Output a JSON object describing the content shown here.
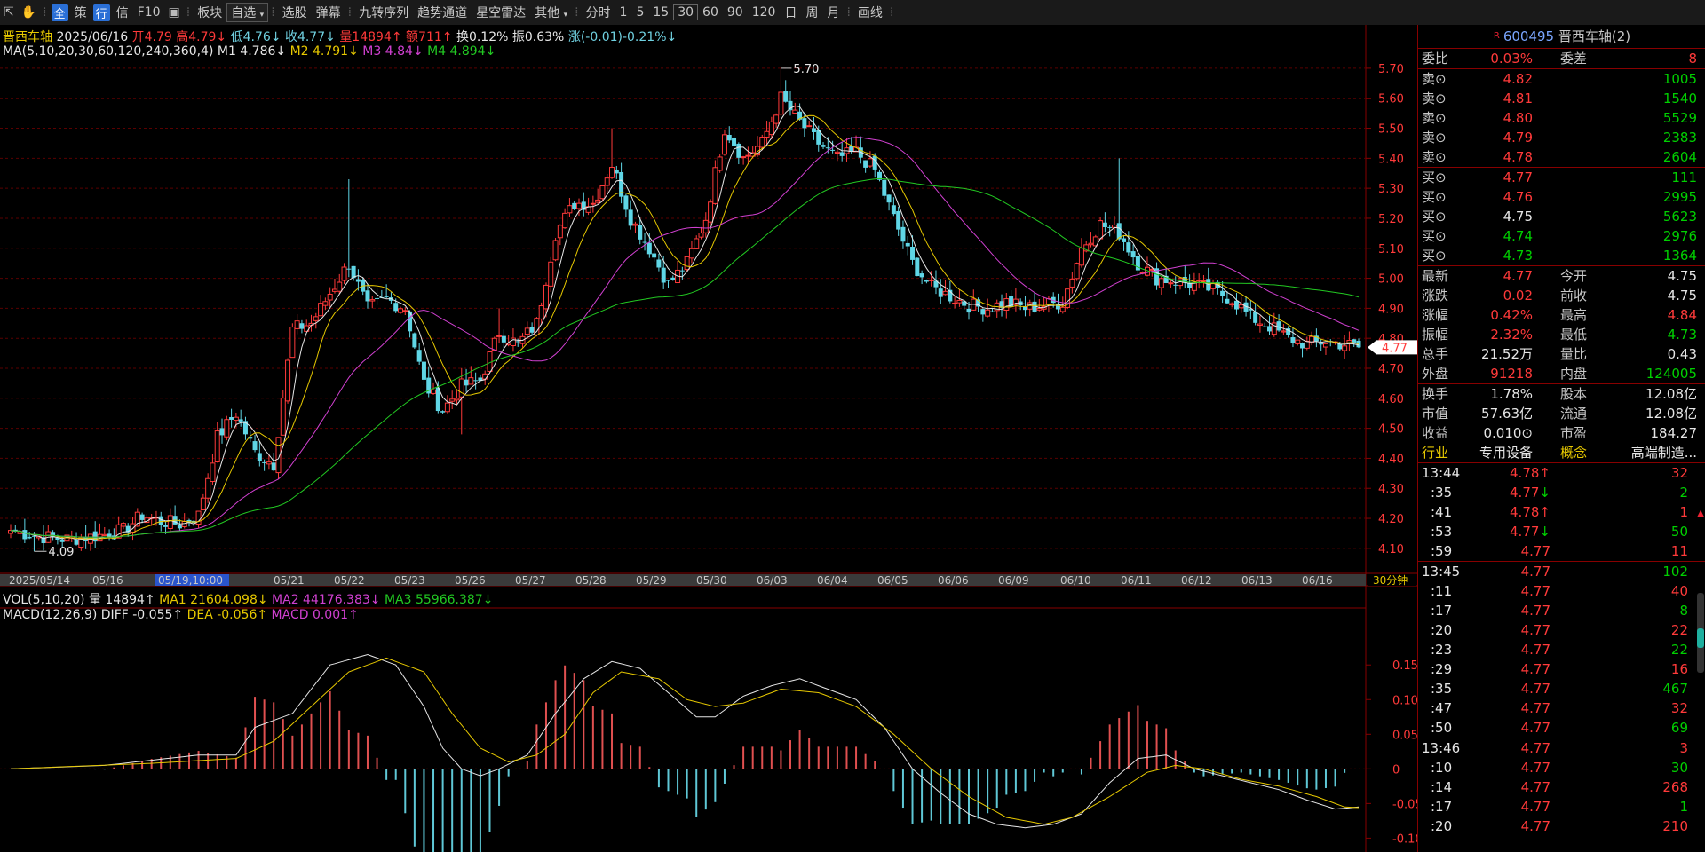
{
  "toolbar": {
    "items": [
      "全",
      "策",
      "行",
      "信",
      "F10",
      "板块",
      "自选",
      "选股",
      "弹幕",
      "九转序列",
      "趋势通道",
      "星空雷达",
      "其他",
      "分时",
      "1",
      "5",
      "15",
      "30",
      "60",
      "90",
      "120",
      "日",
      "周",
      "月",
      "画线"
    ]
  },
  "stock": {
    "name": "晋西车轴",
    "date": "2025/06/16",
    "open": "开4.79",
    "high": "高4.79↓",
    "low": "低4.76↓",
    "close": "收4.77↓",
    "vol": "量14894↑",
    "amt": "额711↑",
    "turn": "换0.12%",
    "amp": "振0.63%",
    "chg": "涨(-0.01)-0.21%↓"
  },
  "ma": {
    "label": "MA(5,10,20,30,60,120,240,360,4)",
    "m1": "M1 4.786↓",
    "m2": "M2 4.791↓",
    "m3": "M3 4.84↓",
    "m4": "M4 4.894↓"
  },
  "vol_ind": {
    "label": "VOL(5,10,20)",
    "v": "量 14894↑",
    "ma1": "MA1 21604.098↓",
    "ma2": "MA2 44176.383↓",
    "ma3": "MA3 55966.387↓"
  },
  "macd": {
    "label": "MACD(12,26,9)",
    "diff": "DIFF -0.055↑",
    "dea": "DEA -0.056↑",
    "macd": "MACD 0.001↑"
  },
  "colors": {
    "up": "#ff3a3a",
    "down": "#00d000",
    "ma1": "#e6e6e6",
    "ma2": "#e6c800",
    "ma3": "#d040d0",
    "ma4": "#22c822",
    "grid": "#5a0000"
  },
  "chart_data": {
    "type": "candlestick",
    "period_label": "30分钟",
    "price_ticks": [
      "5.70",
      "5.60",
      "5.50",
      "5.40",
      "5.30",
      "5.20",
      "5.10",
      "5.00",
      "4.90",
      "4.80",
      "4.70",
      "4.60",
      "4.50",
      "4.40",
      "4.30",
      "4.20",
      "4.10"
    ],
    "price_range": [
      4.07,
      5.75
    ],
    "annotations": {
      "high_label": "5.70",
      "low_label": "4.09",
      "current_price": "4.77"
    },
    "date_labels": [
      "2025/05/14",
      "05/16",
      "05/19,10:00",
      "05/21",
      "05/22",
      "05/23",
      "05/26",
      "05/27",
      "05/28",
      "05/29",
      "05/30",
      "06/03",
      "06/04",
      "06/05",
      "06/06",
      "06/09",
      "06/10",
      "06/11",
      "06/12",
      "06/13",
      "06/16"
    ],
    "close_anchors": [
      [
        0,
        4.16
      ],
      [
        6,
        4.14
      ],
      [
        12,
        4.13
      ],
      [
        18,
        4.14
      ],
      [
        24,
        4.16
      ],
      [
        28,
        4.21
      ],
      [
        32,
        4.19
      ],
      [
        36,
        4.18
      ],
      [
        40,
        4.21
      ],
      [
        44,
        4.47
      ],
      [
        48,
        4.55
      ],
      [
        52,
        4.42
      ],
      [
        56,
        4.38
      ],
      [
        60,
        4.83
      ],
      [
        64,
        4.85
      ],
      [
        68,
        4.95
      ],
      [
        72,
        5.05
      ],
      [
        76,
        4.9
      ],
      [
        80,
        4.93
      ],
      [
        84,
        4.9
      ],
      [
        88,
        4.65
      ],
      [
        92,
        4.56
      ],
      [
        96,
        4.64
      ],
      [
        100,
        4.66
      ],
      [
        104,
        4.82
      ],
      [
        108,
        4.78
      ],
      [
        112,
        4.85
      ],
      [
        116,
        5.15
      ],
      [
        120,
        5.25
      ],
      [
        124,
        5.25
      ],
      [
        128,
        5.38
      ],
      [
        132,
        5.2
      ],
      [
        136,
        5.1
      ],
      [
        140,
        4.98
      ],
      [
        144,
        5.05
      ],
      [
        148,
        5.2
      ],
      [
        152,
        5.5
      ],
      [
        156,
        5.4
      ],
      [
        160,
        5.45
      ],
      [
        164,
        5.6
      ],
      [
        168,
        5.52
      ],
      [
        172,
        5.45
      ],
      [
        176,
        5.4
      ],
      [
        180,
        5.42
      ],
      [
        184,
        5.36
      ],
      [
        188,
        5.2
      ],
      [
        192,
        5.05
      ],
      [
        196,
        4.97
      ],
      [
        200,
        4.94
      ],
      [
        204,
        4.91
      ],
      [
        208,
        4.9
      ],
      [
        212,
        4.92
      ],
      [
        216,
        4.9
      ],
      [
        220,
        4.91
      ],
      [
        224,
        4.92
      ],
      [
        228,
        5.1
      ],
      [
        232,
        5.18
      ],
      [
        236,
        5.15
      ],
      [
        240,
        5.05
      ],
      [
        244,
        5.0
      ],
      [
        248,
        4.99
      ],
      [
        252,
        4.98
      ],
      [
        256,
        4.96
      ],
      [
        260,
        4.93
      ],
      [
        264,
        4.87
      ],
      [
        268,
        4.84
      ],
      [
        272,
        4.8
      ],
      [
        276,
        4.78
      ],
      [
        280,
        4.79
      ],
      [
        284,
        4.78
      ],
      [
        287,
        4.77
      ]
    ],
    "macd_ticks": [
      "0.15",
      "0.10",
      "0.05",
      "0",
      "-0.05",
      "-0.10"
    ],
    "macd_range": [
      -0.12,
      0.19
    ],
    "diff_anchors": [
      [
        0,
        0.0
      ],
      [
        20,
        0.005
      ],
      [
        40,
        0.02
      ],
      [
        48,
        0.02
      ],
      [
        52,
        0.06
      ],
      [
        60,
        0.08
      ],
      [
        68,
        0.15
      ],
      [
        76,
        0.165
      ],
      [
        82,
        0.15
      ],
      [
        88,
        0.09
      ],
      [
        92,
        0.03
      ],
      [
        96,
        0.0
      ],
      [
        100,
        -0.01
      ],
      [
        104,
        0.0
      ],
      [
        110,
        0.02
      ],
      [
        116,
        0.08
      ],
      [
        122,
        0.13
      ],
      [
        128,
        0.155
      ],
      [
        134,
        0.145
      ],
      [
        140,
        0.11
      ],
      [
        146,
        0.075
      ],
      [
        150,
        0.075
      ],
      [
        156,
        0.105
      ],
      [
        162,
        0.12
      ],
      [
        168,
        0.13
      ],
      [
        174,
        0.115
      ],
      [
        180,
        0.1
      ],
      [
        186,
        0.06
      ],
      [
        192,
        0.0
      ],
      [
        198,
        -0.035
      ],
      [
        204,
        -0.065
      ],
      [
        210,
        -0.08
      ],
      [
        216,
        -0.085
      ],
      [
        222,
        -0.08
      ],
      [
        228,
        -0.065
      ],
      [
        234,
        -0.02
      ],
      [
        240,
        0.015
      ],
      [
        246,
        0.02
      ],
      [
        252,
        0.0
      ],
      [
        258,
        -0.01
      ],
      [
        264,
        -0.02
      ],
      [
        270,
        -0.03
      ],
      [
        276,
        -0.045
      ],
      [
        282,
        -0.058
      ],
      [
        287,
        -0.055
      ]
    ],
    "dea_anchors": [
      [
        0,
        0.0
      ],
      [
        30,
        0.008
      ],
      [
        48,
        0.015
      ],
      [
        56,
        0.04
      ],
      [
        64,
        0.09
      ],
      [
        72,
        0.14
      ],
      [
        80,
        0.16
      ],
      [
        88,
        0.14
      ],
      [
        94,
        0.08
      ],
      [
        100,
        0.03
      ],
      [
        106,
        0.01
      ],
      [
        112,
        0.02
      ],
      [
        118,
        0.05
      ],
      [
        124,
        0.11
      ],
      [
        130,
        0.14
      ],
      [
        138,
        0.13
      ],
      [
        144,
        0.1
      ],
      [
        150,
        0.09
      ],
      [
        156,
        0.095
      ],
      [
        164,
        0.115
      ],
      [
        172,
        0.11
      ],
      [
        180,
        0.09
      ],
      [
        188,
        0.05
      ],
      [
        196,
        0.0
      ],
      [
        204,
        -0.04
      ],
      [
        212,
        -0.07
      ],
      [
        220,
        -0.08
      ],
      [
        226,
        -0.07
      ],
      [
        234,
        -0.04
      ],
      [
        242,
        -0.005
      ],
      [
        248,
        0.005
      ],
      [
        254,
        0.0
      ],
      [
        262,
        -0.015
      ],
      [
        270,
        -0.025
      ],
      [
        278,
        -0.04
      ],
      [
        284,
        -0.055
      ],
      [
        287,
        -0.056
      ]
    ],
    "n": 288
  },
  "quote": {
    "code": "600495",
    "name": "晋西车轴(2)",
    "badge": "R",
    "weibi_label": "委比",
    "weibi": "0.03%",
    "weicha_label": "委差",
    "weicha": "8",
    "sell": [
      {
        "label": "卖⊙",
        "price": "4.82",
        "vol": "1005"
      },
      {
        "label": "卖⊙",
        "price": "4.81",
        "vol": "1540"
      },
      {
        "label": "卖⊙",
        "price": "4.80",
        "vol": "5529"
      },
      {
        "label": "卖⊙",
        "price": "4.79",
        "vol": "2383"
      },
      {
        "label": "卖⊙",
        "price": "4.78",
        "vol": "2604"
      }
    ],
    "buy": [
      {
        "label": "买⊙",
        "price": "4.77",
        "vol": "111"
      },
      {
        "label": "买⊙",
        "price": "4.76",
        "vol": "2995"
      },
      {
        "label": "买⊙",
        "price": "4.75",
        "vol": "5623"
      },
      {
        "label": "买⊙",
        "price": "4.74",
        "vol": "2976"
      },
      {
        "label": "买⊙",
        "price": "4.73",
        "vol": "1364"
      }
    ],
    "stats": [
      {
        "l1": "最新",
        "v1": "4.77",
        "l2": "今开",
        "v2": "4.75"
      },
      {
        "l1": "涨跌",
        "v1": "0.02",
        "l2": "前收",
        "v2": "4.75"
      },
      {
        "l1": "涨幅",
        "v1": "0.42%",
        "l2": "最高",
        "v2": "4.84"
      },
      {
        "l1": "振幅",
        "v1": "2.32%",
        "l2": "最低",
        "v2": "4.73"
      },
      {
        "l1": "总手",
        "v1": "21.52万",
        "l2": "量比",
        "v2": "0.43"
      },
      {
        "l1": "外盘",
        "v1": "91218",
        "l2": "内盘",
        "v2": "124005"
      }
    ],
    "fund": [
      {
        "l1": "换手",
        "v1": "1.78%",
        "l2": "股本",
        "v2": "12.08亿"
      },
      {
        "l1": "市值",
        "v1": "57.63亿",
        "l2": "流通",
        "v2": "12.08亿"
      },
      {
        "l1": "收益",
        "v1": "0.010⊙",
        "l2": "市盈",
        "v2": "184.27"
      },
      {
        "l1": "行业",
        "v1": "专用设备",
        "l2": "概念",
        "v2": "高端制造..."
      }
    ],
    "ticks": [
      {
        "t": "13:44",
        "p": "4.78↑",
        "v": "32"
      },
      {
        "t": ":35",
        "p": "4.77↓",
        "v": "2"
      },
      {
        "t": ":41",
        "p": "4.78↑",
        "v": "1"
      },
      {
        "t": ":53",
        "p": "4.77↓",
        "v": "50"
      },
      {
        "t": ":59",
        "p": "4.77",
        "v": "11"
      },
      {
        "t": "13:45",
        "p": "4.77",
        "v": "102"
      },
      {
        "t": ":11",
        "p": "4.77",
        "v": "40"
      },
      {
        "t": ":17",
        "p": "4.77",
        "v": "8"
      },
      {
        "t": ":20",
        "p": "4.77",
        "v": "22"
      },
      {
        "t": ":23",
        "p": "4.77",
        "v": "22"
      },
      {
        "t": ":29",
        "p": "4.77",
        "v": "16"
      },
      {
        "t": ":35",
        "p": "4.77",
        "v": "467"
      },
      {
        "t": ":47",
        "p": "4.77",
        "v": "32"
      },
      {
        "t": ":50",
        "p": "4.77",
        "v": "69"
      },
      {
        "t": "13:46",
        "p": "4.77",
        "v": "3"
      },
      {
        "t": ":10",
        "p": "4.77",
        "v": "30"
      },
      {
        "t": ":14",
        "p": "4.77",
        "v": "268"
      },
      {
        "t": ":17",
        "p": "4.77",
        "v": "1"
      },
      {
        "t": ":20",
        "p": "4.77",
        "v": "210"
      }
    ]
  }
}
